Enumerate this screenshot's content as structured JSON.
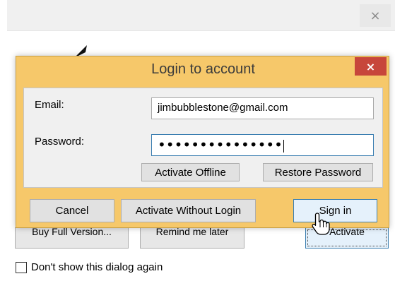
{
  "background_window": {
    "close_glyph": "×",
    "buttons": {
      "buy_label": "Buy Full Version...",
      "remind_label": "Remind me later",
      "activate_label": "Activate"
    },
    "checkbox_label": "Don't show this dialog again",
    "checkbox_checked": false
  },
  "dialog": {
    "title": "Login to account",
    "close_glyph": "×",
    "accent_color": "#f6c86a",
    "close_color": "#c7463b",
    "email_label": "Email:",
    "email_value": "jimbubblestone@gmail.com",
    "password_label": "Password:",
    "password_value": "•••••••••••••••",
    "activate_offline_label": "Activate Offline",
    "restore_password_label": "Restore Password",
    "cancel_label": "Cancel",
    "activate_without_login_label": "Activate Without Login",
    "sign_in_label": "Sign in"
  },
  "icons": {
    "cursor": "hand-pointer-icon",
    "logo": "logo-icon"
  }
}
